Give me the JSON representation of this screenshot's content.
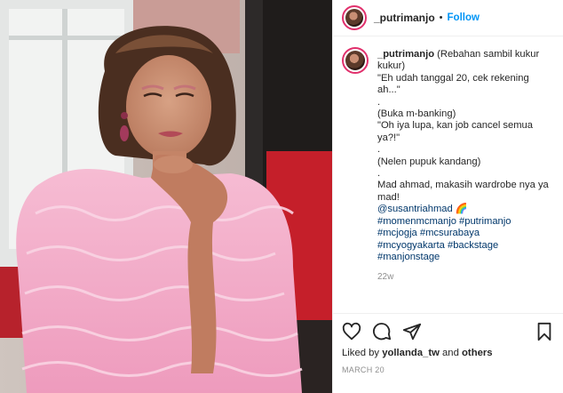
{
  "post": {
    "username": "_putrimanjo",
    "follow_label": "Follow",
    "separator": "•"
  },
  "caption": {
    "username": "_putrimanjo",
    "lines": [
      "(Rebahan sambil kukur kukur)",
      "\"Eh udah tanggal 20, cek rekening ah...\"",
      ".",
      "(Buka m-banking)",
      "\"Oh iya lupa, kan job cancel semua ya?!\"",
      ".",
      "(Nelen pupuk kandang)",
      ".",
      "Mad ahmad, makasih wardrobe nya ya mad!"
    ],
    "mention": "@susantriahmad 🌈",
    "hashtags": [
      "#momenmcmanjo #putrimanjo",
      "#mcjogja #mcsurabaya",
      "#mcyogyakarta #backstage",
      "#manjonstage"
    ],
    "time_ago": "22w"
  },
  "engagement": {
    "liked_by_prefix": "Liked by ",
    "liked_by_user": "yollanda_tw",
    "liked_by_suffix": " and ",
    "liked_by_others": "others",
    "date": "MARCH 20"
  },
  "icons": {
    "like": "heart-icon",
    "comment": "comment-icon",
    "share": "share-icon",
    "save": "bookmark-icon"
  },
  "colors": {
    "follow": "#0095f6",
    "hashtag": "#00376b",
    "muted": "#8e8e8e",
    "dress": "#f2a6c4"
  }
}
